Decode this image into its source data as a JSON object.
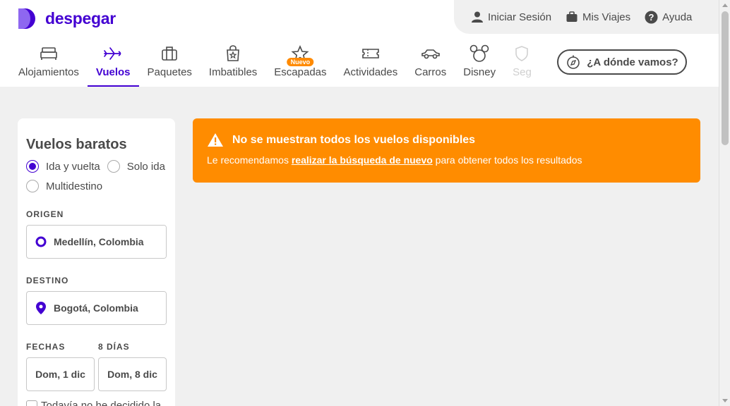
{
  "brand": {
    "name": "despegar",
    "color": "#4300d2"
  },
  "userbar": {
    "login": "Iniciar Sesión",
    "trips": "Mis Viajes",
    "help": "Ayuda"
  },
  "nav": {
    "items": [
      {
        "label": "Alojamientos",
        "icon": "bed-icon"
      },
      {
        "label": "Vuelos",
        "icon": "plane-icon",
        "active": true
      },
      {
        "label": "Paquetes",
        "icon": "suitcase-icon"
      },
      {
        "label": "Imbatibles",
        "icon": "star-bag-icon"
      },
      {
        "label": "Escapadas",
        "icon": "star-icon",
        "badge": "Nuevo"
      },
      {
        "label": "Actividades",
        "icon": "ticket-icon"
      },
      {
        "label": "Carros",
        "icon": "car-icon"
      },
      {
        "label": "Disney",
        "icon": "mickey-icon"
      },
      {
        "label": "Seg",
        "icon": "insurance-icon"
      }
    ],
    "where_button": "¿A dónde vamos?"
  },
  "search": {
    "title": "Vuelos baratos",
    "trip_types": [
      "Ida y vuelta",
      "Solo ida",
      "Multidestino"
    ],
    "selected_trip_type": "Ida y vuelta",
    "origin_label": "ORIGEN",
    "origin_value": "Medellín, Colombia",
    "destination_label": "DESTINO",
    "destination_value": "Bogotá, Colombia",
    "dates_label": "FECHAS",
    "days_label": "8 DÍAS",
    "date_from": "Dom, 1 dic",
    "date_to": "Dom, 8 dic",
    "undecided_label": "Todavía no he decidido la"
  },
  "alert": {
    "color": "#ff8c00",
    "title": "No se muestran todos los vuelos disponibles",
    "text_before": "Le recomendamos ",
    "link": "realizar la búsqueda de nuevo",
    "text_after": " para obtener todos los resultados"
  }
}
